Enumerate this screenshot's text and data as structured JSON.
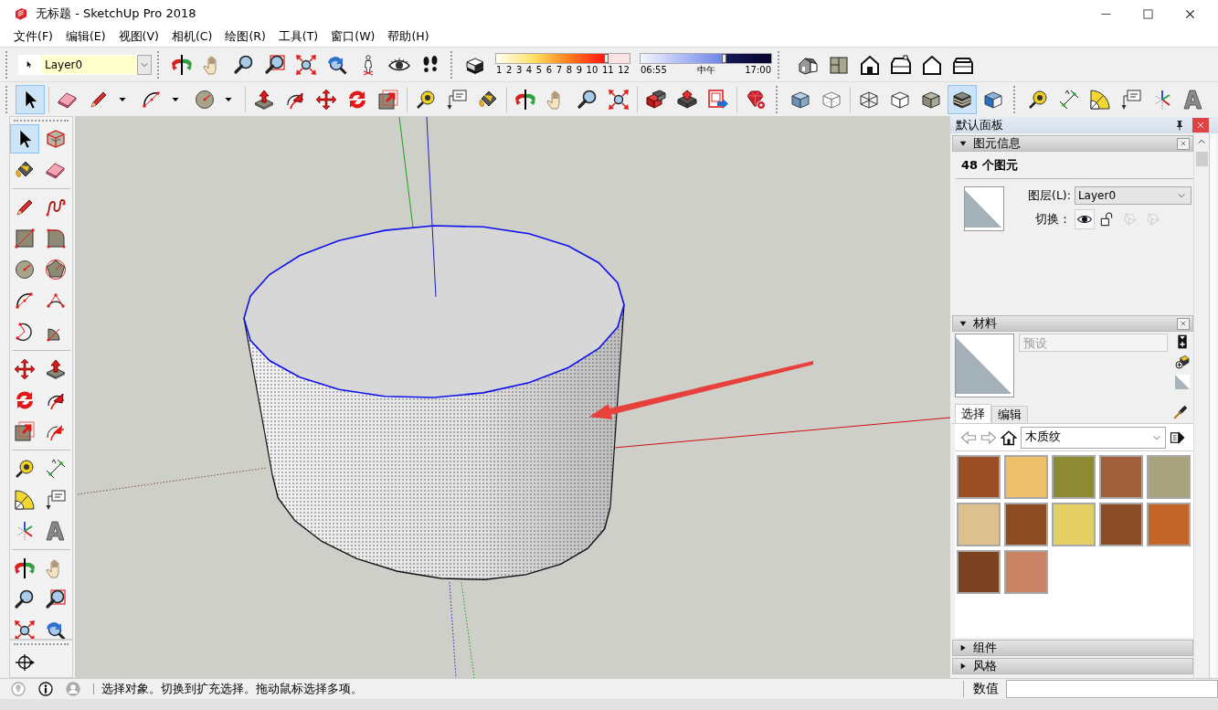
{
  "window": {
    "title": "无标题 - SketchUp Pro 2018"
  },
  "menu": [
    "文件(F)",
    "编辑(E)",
    "视图(V)",
    "相机(C)",
    "绘图(R)",
    "工具(T)",
    "窗口(W)",
    "帮助(H)"
  ],
  "toolbar_row_1": {
    "layer": {
      "value": "Layer0"
    },
    "camera_tools": [
      {
        "kind": "orbit",
        "selected": false
      },
      {
        "kind": "pan",
        "selected": false
      },
      {
        "kind": "zoom",
        "selected": false
      },
      {
        "kind": "zoom-window",
        "selected": false
      },
      {
        "kind": "zoom-extents",
        "selected": false
      },
      {
        "kind": "previous",
        "selected": false
      },
      {
        "kind": "position-camera",
        "selected": false
      },
      {
        "kind": "look-around",
        "selected": false
      },
      {
        "kind": "walk",
        "selected": false
      }
    ],
    "shadows": {
      "toggle": {
        "kind": "shadow",
        "selected": false
      },
      "month": {
        "level": 0.83,
        "ticks": [
          "1",
          "2",
          "3",
          "4",
          "5",
          "6",
          "7",
          "8",
          "9",
          "10",
          "11",
          "12"
        ]
      },
      "time": {
        "level": 0.64,
        "start": "06:55",
        "middle": "中午",
        "end": "17:00"
      }
    },
    "views": [
      {
        "kind": "iso",
        "selected": false
      },
      {
        "kind": "top",
        "selected": false
      },
      {
        "kind": "front",
        "selected": false
      },
      {
        "kind": "right",
        "selected": false
      },
      {
        "kind": "back",
        "selected": false
      },
      {
        "kind": "left",
        "selected": false
      }
    ]
  },
  "toolbar_row_2": [
    [
      [
        {
          "kind": "select",
          "selected": true
        }
      ],
      [
        {
          "kind": "eraser",
          "selected": false
        },
        {
          "kind": "pencil",
          "selected": false
        },
        {
          "kind": "caret",
          "selected": false
        },
        {
          "kind": "arc",
          "selected": false
        },
        {
          "kind": "caret",
          "selected": false
        },
        {
          "kind": "circle",
          "selected": false
        },
        {
          "kind": "caret",
          "selected": false
        }
      ],
      [
        {
          "kind": "push-pull",
          "selected": false
        },
        {
          "kind": "follow-me",
          "selected": false
        },
        {
          "kind": "move",
          "selected": false
        },
        {
          "kind": "rotate",
          "selected": false
        },
        {
          "kind": "scale",
          "selected": false
        }
      ],
      [
        {
          "kind": "tape",
          "selected": false
        },
        {
          "kind": "text",
          "selected": false
        },
        {
          "kind": "paint",
          "selected": false
        }
      ],
      [
        {
          "kind": "orbit",
          "selected": false
        },
        {
          "kind": "pan",
          "selected": false
        },
        {
          "kind": "zoom",
          "selected": false
        },
        {
          "kind": "zoom-extents",
          "selected": false
        }
      ],
      [
        {
          "kind": "warehouse",
          "selected": false
        },
        {
          "kind": "extension-warehouse",
          "selected": false
        },
        {
          "kind": "send-to-layout",
          "selected": false
        }
      ],
      [
        {
          "kind": "extension-manager",
          "selected": false
        }
      ]
    ],
    [
      [
        {
          "kind": "x-ray",
          "selected": false
        },
        {
          "kind": "back-edges",
          "selected": false
        }
      ],
      [
        {
          "kind": "wireframe",
          "selected": false
        },
        {
          "kind": "hidden-line",
          "selected": false
        },
        {
          "kind": "shaded",
          "selected": false
        },
        {
          "kind": "shaded-textures",
          "selected": true
        },
        {
          "kind": "monochrome",
          "selected": false
        }
      ]
    ],
    [
      [
        {
          "kind": "tape",
          "selected": false
        },
        {
          "kind": "dimension",
          "selected": false
        },
        {
          "kind": "protractor",
          "selected": false
        },
        {
          "kind": "text",
          "selected": false
        },
        {
          "kind": "axes",
          "selected": false
        },
        {
          "kind": "text-3d",
          "selected": false
        }
      ]
    ]
  ],
  "left_toolbar": [
    [
      {
        "kind": "select",
        "selected": true
      },
      {
        "kind": "component",
        "selected": false
      },
      {
        "kind": "paint",
        "selected": false
      },
      {
        "kind": "eraser",
        "selected": false
      }
    ],
    [
      {
        "kind": "pencil",
        "selected": false
      },
      {
        "kind": "freehand",
        "selected": false
      },
      {
        "kind": "rectangle",
        "selected": false
      },
      {
        "kind": "rotated-rectangle",
        "selected": false
      },
      {
        "kind": "circle",
        "selected": false
      },
      {
        "kind": "polygon",
        "selected": false
      },
      {
        "kind": "arc",
        "selected": false
      },
      {
        "kind": "arc-2pt",
        "selected": false
      },
      {
        "kind": "arc-3pt",
        "selected": false
      },
      {
        "kind": "pie",
        "selected": false
      }
    ],
    [
      {
        "kind": "move",
        "selected": false
      },
      {
        "kind": "push-pull",
        "selected": false
      },
      {
        "kind": "rotate",
        "selected": false
      },
      {
        "kind": "follow-me",
        "selected": false
      },
      {
        "kind": "scale",
        "selected": false
      },
      {
        "kind": "offset",
        "selected": false
      }
    ],
    [
      {
        "kind": "tape",
        "selected": false
      },
      {
        "kind": "dimension",
        "selected": false
      },
      {
        "kind": "protractor",
        "selected": false
      },
      {
        "kind": "text",
        "selected": false
      },
      {
        "kind": "axes",
        "selected": false
      },
      {
        "kind": "text-3d",
        "selected": false
      }
    ],
    [
      {
        "kind": "orbit",
        "selected": false
      },
      {
        "kind": "pan",
        "selected": false
      },
      {
        "kind": "zoom",
        "selected": false
      },
      {
        "kind": "zoom-window",
        "selected": false
      },
      {
        "kind": "zoom-extents",
        "selected": false
      },
      {
        "kind": "previous",
        "selected": false
      }
    ]
  ],
  "left_toolbar_2": [
    {
      "kind": "location",
      "selected": false
    }
  ],
  "tray": {
    "title": "默认面板",
    "entity_info": {
      "title": "图元信息",
      "expanded": true,
      "summary": "48 个图元",
      "layer_label": "图层(L):",
      "layer": "Layer0",
      "toggle_label": "切换：",
      "toggles": [
        {
          "kind": "visible",
          "on": true,
          "disabled": false
        },
        {
          "kind": "lock",
          "on": false,
          "disabled": false
        },
        {
          "kind": "cast-shadows",
          "on": false,
          "disabled": true
        },
        {
          "kind": "receive-shadows",
          "on": false,
          "disabled": true
        }
      ]
    },
    "materials": {
      "title": "材料",
      "expanded": true,
      "name_placeholder": "预设",
      "tabs": [
        {
          "label": "选择",
          "selected": true
        },
        {
          "label": "编辑",
          "selected": false
        }
      ],
      "library": "木质纹",
      "swatches": [
        {
          "color": "#9c4f27"
        },
        {
          "color": "#efc06c"
        },
        {
          "color": "#8c8a33"
        },
        {
          "color": "#a15f3b"
        },
        {
          "color": "#a9a27f"
        },
        {
          "color": "#dcc08e"
        },
        {
          "color": "#8e4c24"
        },
        {
          "color": "#e4d064"
        },
        {
          "color": "#8a4d26"
        },
        {
          "color": "#c4662a"
        },
        {
          "color": "#7b4321"
        },
        {
          "color": "#c98263"
        }
      ]
    },
    "components": {
      "title": "组件",
      "expanded": false
    },
    "styles": {
      "title": "风格",
      "expanded": false
    }
  },
  "status_bar": {
    "message": "选择对象。切换到扩充选择。拖动鼠标选择多项。",
    "measurements_label": "数值"
  }
}
